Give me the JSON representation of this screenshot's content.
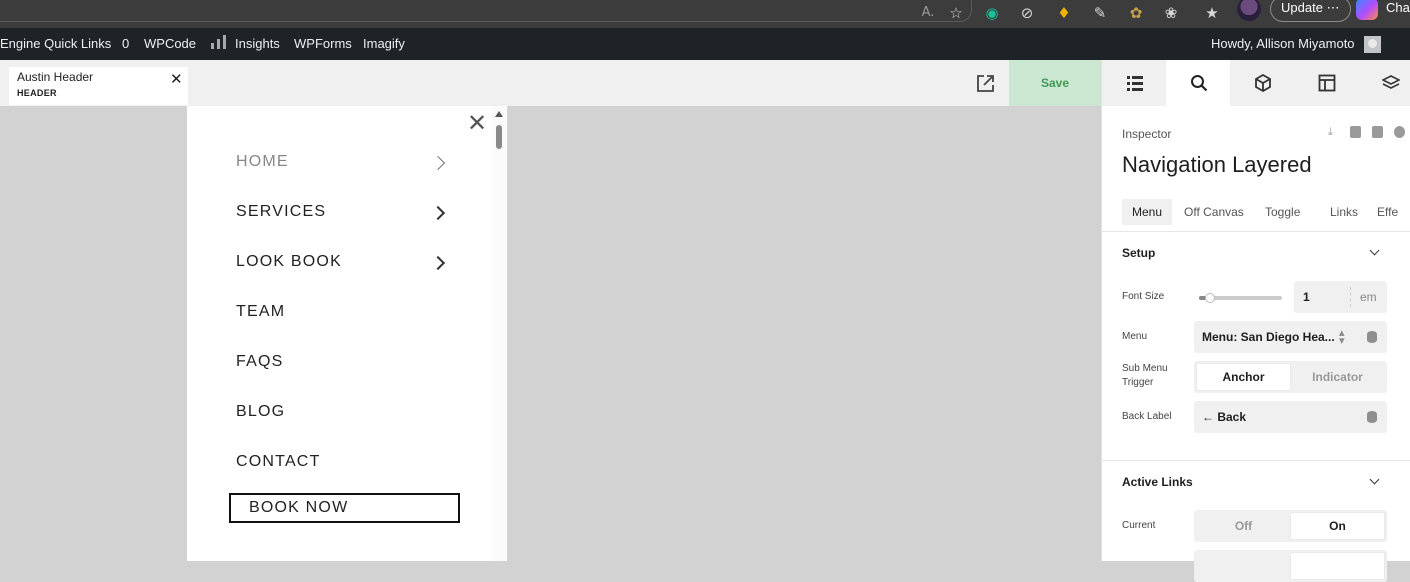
{
  "browser": {
    "update_label": "Update ⋯",
    "chat_label": "Chat"
  },
  "adminbar": {
    "quick_links": "Engine Quick Links",
    "count": "0",
    "wpcode": "WPCode",
    "insights": "Insights",
    "wpforms": "WPForms",
    "imagify": "Imagify",
    "howdy": "Howdy, Allison Miyamoto"
  },
  "topbar": {
    "doc_title": "Austin Header",
    "doc_type": "HEADER",
    "save_label": "Save"
  },
  "offcanvas": {
    "menu_items": [
      {
        "label": "HOME",
        "has_children": true
      },
      {
        "label": "SERVICES",
        "has_children": true
      },
      {
        "label": "LOOK BOOK",
        "has_children": true
      },
      {
        "label": "TEAM",
        "has_children": false
      },
      {
        "label": "FAQS",
        "has_children": false
      },
      {
        "label": "BLOG",
        "has_children": false
      },
      {
        "label": "CONTACT",
        "has_children": false
      }
    ],
    "book_now": "BOOK NOW"
  },
  "inspector": {
    "label": "Inspector",
    "title": "Navigation Layered",
    "tabs": [
      "Menu",
      "Off Canvas",
      "Toggle",
      "Links",
      "Effe"
    ],
    "active_tab": "Menu",
    "setup": {
      "header": "Setup",
      "font_size_label": "Font Size",
      "font_size_value": "1",
      "font_size_unit": "em",
      "menu_label": "Menu",
      "menu_value": "Menu: San Diego Hea...",
      "submenu_trigger_label": "Sub Menu Trigger",
      "submenu_options": [
        "Anchor",
        "Indicator"
      ],
      "submenu_selected": "Anchor",
      "back_label_label": "Back Label",
      "back_label_value": "← Back"
    },
    "active_links": {
      "header": "Active Links",
      "current_label": "Current",
      "current_options": [
        "Off",
        "On"
      ],
      "current_selected": "On"
    }
  },
  "colors": {
    "save_bg": "#cbe7d1",
    "save_text": "#3e9a55",
    "admin_bar": "#1d2327"
  }
}
